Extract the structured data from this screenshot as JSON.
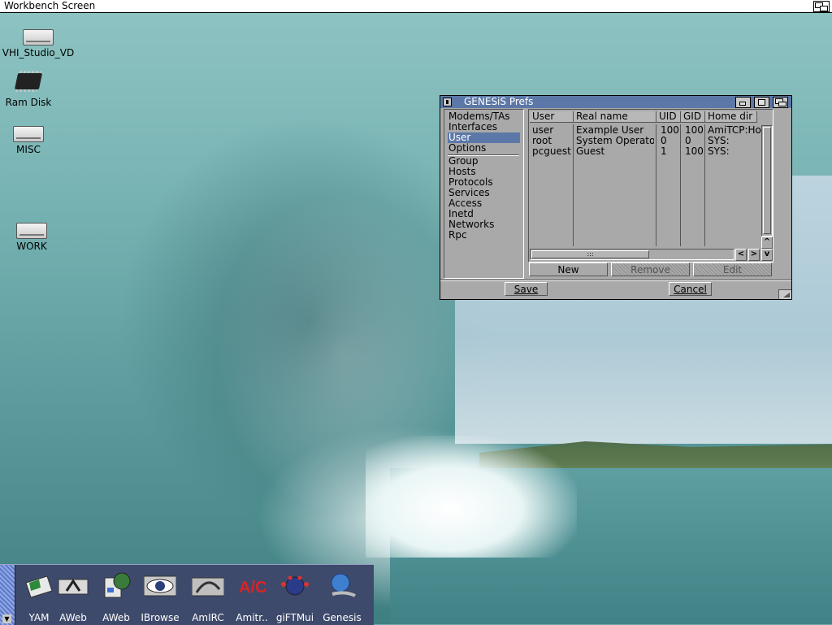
{
  "screen": {
    "title": "Workbench Screen"
  },
  "desktop_icons": [
    {
      "label": "VHI_Studio_VD",
      "icon": "drive-icon"
    },
    {
      "label": "Ram Disk",
      "icon": "ram-chip-icon"
    },
    {
      "label": "MISC",
      "icon": "drive-icon"
    },
    {
      "label": "WORK",
      "icon": "drive-icon"
    }
  ],
  "prefs_window": {
    "title": "GENESiS Prefs",
    "categories_top": [
      "Modems/TAs",
      "Interfaces",
      "User",
      "Options"
    ],
    "categories_bottom": [
      "Group",
      "Hosts",
      "Protocols",
      "Services",
      "Access",
      "Inetd",
      "Networks",
      "Rpc"
    ],
    "selected_category": "User",
    "table": {
      "columns": [
        "User",
        "Real name",
        "UID",
        "GID",
        "Home dir"
      ],
      "rows": [
        [
          "user",
          "Example User",
          "100",
          "100",
          "AmiTCP:Ho"
        ],
        [
          "root",
          "System Operator",
          "0",
          "0",
          "SYS:"
        ],
        [
          "pcguest",
          "Guest",
          "1",
          "100",
          "SYS:"
        ]
      ]
    },
    "buttons": {
      "new": "New",
      "remove": "Remove",
      "edit": "Edit",
      "save": "Save",
      "cancel": "Cancel"
    },
    "scroll_arrows": {
      "up": "^",
      "down": "v",
      "left": "<",
      "right": ">"
    }
  },
  "dock": {
    "items": [
      {
        "label": "YAM",
        "icon": "yam-mail-icon"
      },
      {
        "label": "AWeb",
        "icon": "aweb-icon"
      },
      {
        "label": "AWeb",
        "icon": "aweb-globe-icon"
      },
      {
        "label": "IBrowse",
        "icon": "ibrowse-eye-icon"
      },
      {
        "label": "AmIRC",
        "icon": "amirc-icon"
      },
      {
        "label": "Amitr..",
        "icon": "amitradio-icon"
      },
      {
        "label": "giFTMui",
        "icon": "giftmui-icon"
      },
      {
        "label": "Genesis",
        "icon": "genesis-icon"
      }
    ]
  }
}
